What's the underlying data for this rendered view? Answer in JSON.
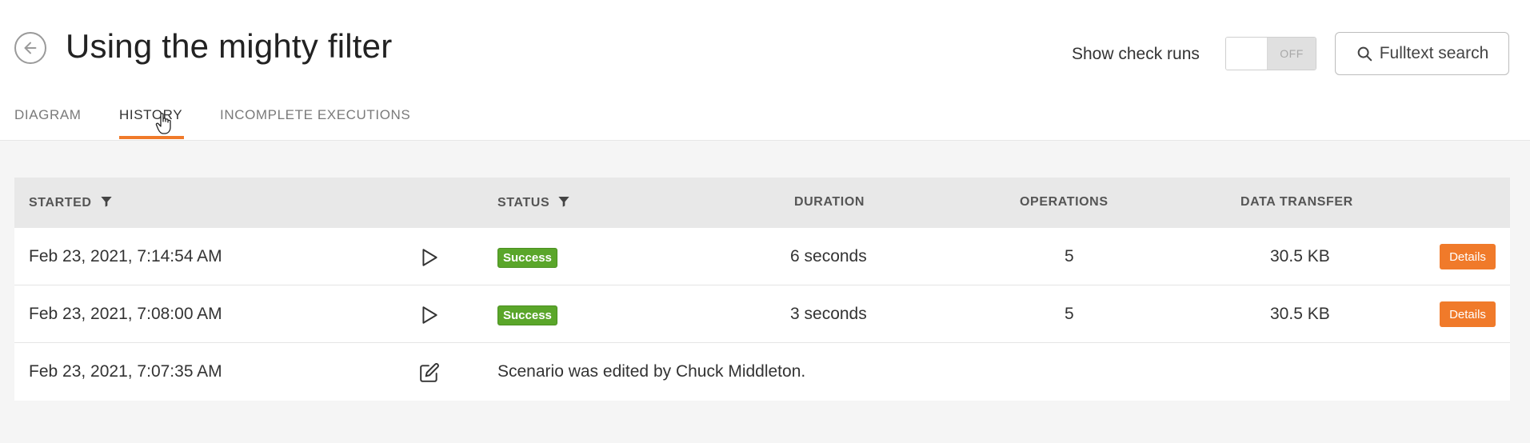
{
  "header": {
    "title": "Using the mighty filter",
    "check_runs_label": "Show check runs",
    "toggle_state": "OFF",
    "search_label": "Fulltext search"
  },
  "tabs": [
    {
      "label": "DIAGRAM",
      "active": false
    },
    {
      "label": "HISTORY",
      "active": true
    },
    {
      "label": "INCOMPLETE EXECUTIONS",
      "active": false
    }
  ],
  "table": {
    "columns": [
      "STARTED",
      "STATUS",
      "DURATION",
      "OPERATIONS",
      "DATA TRANSFER"
    ],
    "rows": [
      {
        "started": "Feb 23, 2021, 7:14:54 AM",
        "icon": "play-icon",
        "status": "Success",
        "duration": "6 seconds",
        "operations": "5",
        "data_transfer": "30.5 KB",
        "action": "Details"
      },
      {
        "started": "Feb 23, 2021, 7:08:00 AM",
        "icon": "play-icon",
        "status": "Success",
        "duration": "3 seconds",
        "operations": "5",
        "data_transfer": "30.5 KB",
        "action": "Details"
      },
      {
        "started": "Feb 23, 2021, 7:07:35 AM",
        "icon": "edit-icon",
        "message": "Scenario was edited by Chuck Middleton."
      }
    ]
  },
  "colors": {
    "accent": "#f07a2a",
    "success": "#5aa62a",
    "header_bg": "#e8e8e8"
  }
}
